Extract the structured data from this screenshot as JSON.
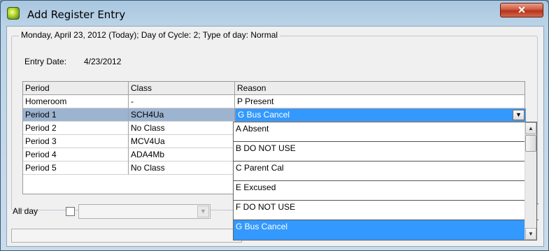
{
  "window": {
    "title": "Add Register Entry",
    "close_glyph": "✕"
  },
  "group": {
    "legend": "Monday, April 23, 2012 (Today); Day of Cycle: 2; Type of day: Normal"
  },
  "entry": {
    "label": "Entry Date:",
    "value": "4/23/2012"
  },
  "grid": {
    "headers": [
      "Period",
      "Class",
      "Reason"
    ],
    "rows": [
      {
        "period": "Homeroom",
        "class": "-",
        "reason": "P Present"
      },
      {
        "period": "Period 1",
        "class": "SCH4Ua",
        "reason": "G Bus Cancel"
      },
      {
        "period": "Period 2",
        "class": "No Class",
        "reason": ""
      },
      {
        "period": "Period 3",
        "class": "MCV4Ua",
        "reason": ""
      },
      {
        "period": "Period 4",
        "class": "ADA4Mb",
        "reason": ""
      },
      {
        "period": "Period 5",
        "class": "No Class",
        "reason": ""
      }
    ]
  },
  "dropdown": {
    "options": [
      "A Absent",
      "B DO NOT USE",
      "C Parent Cal",
      "E Excused",
      "F DO NOT USE",
      "G Bus Cancel"
    ],
    "selected": "G Bus Cancel"
  },
  "allday": {
    "label": "All day",
    "checked": false,
    "value": ""
  },
  "colors": {
    "selection": "#3399ff",
    "row_highlight": "#9cb4d0"
  }
}
